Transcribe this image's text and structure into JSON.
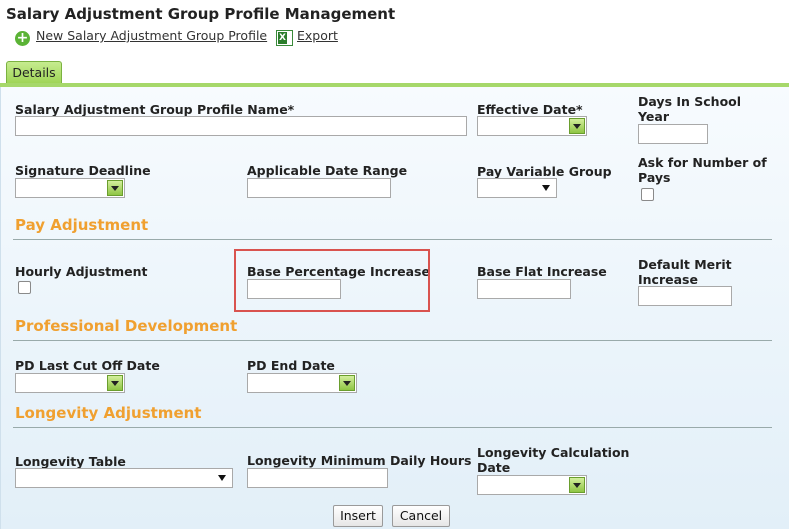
{
  "page": {
    "title": "Salary Adjustment Group Profile Management",
    "new_link": "New Salary Adjustment Group Profile",
    "export_link": "Export"
  },
  "tabs": [
    "Details"
  ],
  "fields": {
    "profile_name": "Salary Adjustment Group Profile Name*",
    "effective_date": "Effective Date*",
    "days_in_school_year_1": "Days In School",
    "days_in_school_year_2": "Year",
    "signature_deadline": "Signature Deadline",
    "applicable_date_range": "Applicable Date Range",
    "pay_variable_group": "Pay Variable Group",
    "ask_pays_1": "Ask for Number of",
    "ask_pays_2": "Pays"
  },
  "sections": {
    "pay": {
      "title": "Pay Adjustment",
      "hourly": "Hourly Adjustment",
      "base_pct": "Base Percentage Increase",
      "base_flat": "Base Flat Increase",
      "merit_1": "Default Merit",
      "merit_2": "Increase"
    },
    "pd": {
      "title": "Professional Development",
      "last_cut": "PD Last Cut Off Date",
      "end_date": "PD End Date"
    },
    "longevity": {
      "title": "Longevity Adjustment",
      "table": "Longevity Table",
      "min_hours": "Longevity Minimum Daily Hours",
      "calc_1": "Longevity Calculation",
      "calc_2": "Date"
    }
  },
  "buttons": {
    "insert": "Insert",
    "cancel": "Cancel"
  },
  "colors": {
    "section_title": "#f0a030",
    "tab_green": "#a6d86a",
    "highlight": "#d9534f"
  }
}
